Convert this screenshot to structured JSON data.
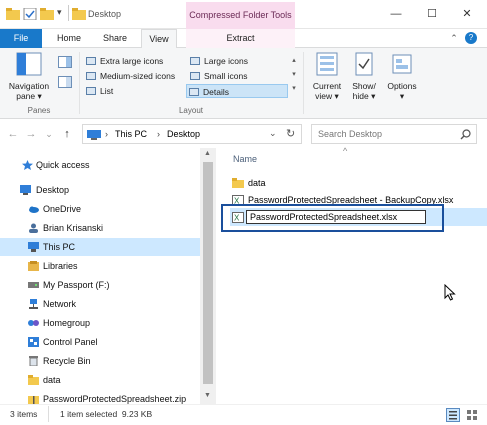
{
  "window": {
    "title": "Desktop",
    "context_tab_header": "Compressed Folder Tools",
    "minimize": "—",
    "maximize": "☐",
    "close": "✕"
  },
  "tabs": {
    "file": "File",
    "home": "Home",
    "share": "Share",
    "view": "View",
    "extract": "Extract",
    "collapse_icon": "chevron-up-icon",
    "help_icon": "help-icon"
  },
  "ribbon": {
    "navigation_pane_line1": "Navigation",
    "navigation_pane_line2": "pane ▾",
    "panes_group": "Panes",
    "layout_group": "Layout",
    "layout_items": [
      "Extra large icons",
      "Large icons",
      "Medium-sized icons",
      "Small icons",
      "List",
      "Details"
    ],
    "current_view_line1": "Current",
    "current_view_line2": "view ▾",
    "show_hide_line1": "Show/",
    "show_hide_line2": "hide ▾",
    "options": "Options",
    "options_arrow": "▾"
  },
  "address": {
    "back": "←",
    "forward": "→",
    "recent": "⌄",
    "up": "↑",
    "crumbs": [
      "This PC",
      "Desktop"
    ],
    "separator": "›",
    "dropdown": "⌄",
    "refresh": "↻",
    "search_placeholder": "Search Desktop"
  },
  "nav": {
    "items": [
      "Quick access",
      "Desktop",
      "OneDrive",
      "Brian Krisanski",
      "This PC",
      "Libraries",
      "My Passport (F:)",
      "Network",
      "Homegroup",
      "Control Panel",
      "Recycle Bin",
      "data",
      "PasswordProtectedSpreadsheet.zip"
    ]
  },
  "content": {
    "column_name": "Name",
    "sort_indicator": "^",
    "files": [
      "data",
      "PasswordProtectedSpreadsheet - BackupCopy.xlsx"
    ],
    "rename_value": "PasswordProtectedSpreadsheet.xlsx"
  },
  "status": {
    "item_count": "3 items",
    "selection": "1 item selected  9.23 KB"
  },
  "colors": {
    "accent": "#1979ca",
    "selection": "#cde8ff",
    "rename_box": "#1a4f9c",
    "context_tab": "#f9dcee",
    "folder": "#f3c94e"
  }
}
